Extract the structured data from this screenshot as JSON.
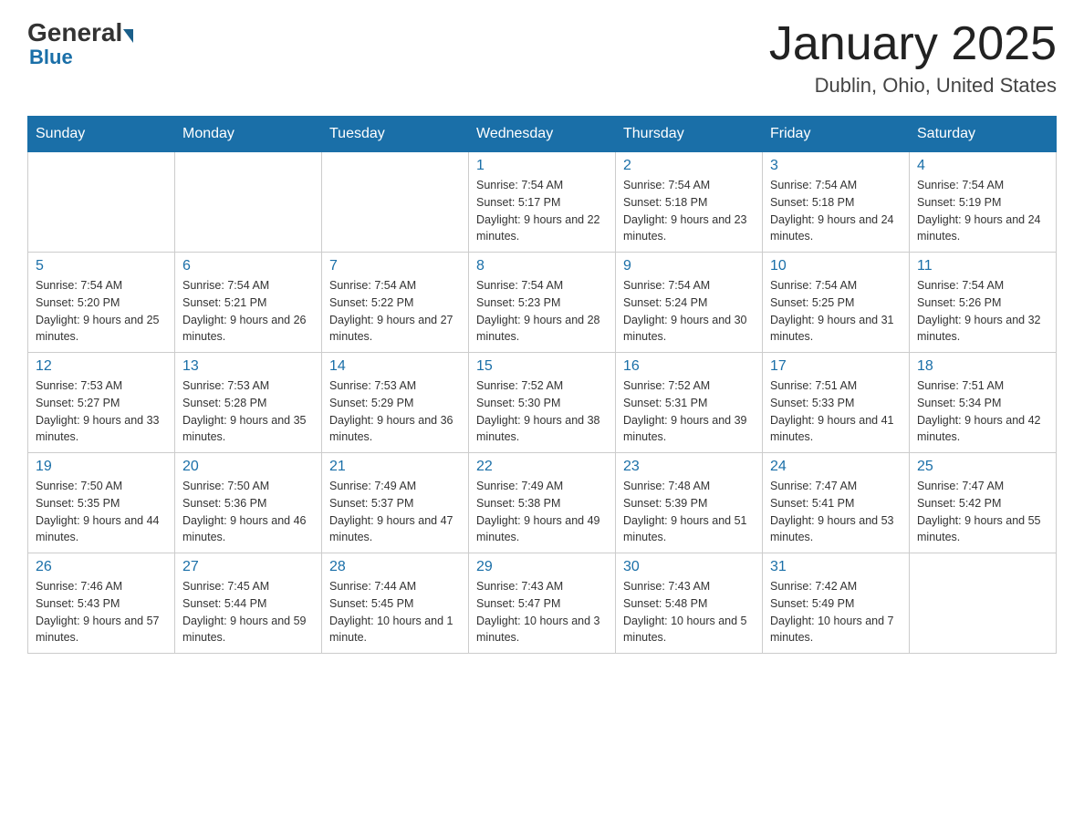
{
  "header": {
    "logo_general": "General",
    "logo_blue": "Blue",
    "month_title": "January 2025",
    "location": "Dublin, Ohio, United States"
  },
  "weekdays": [
    "Sunday",
    "Monday",
    "Tuesday",
    "Wednesday",
    "Thursday",
    "Friday",
    "Saturday"
  ],
  "weeks": [
    [
      {
        "day": "",
        "sunrise": "",
        "sunset": "",
        "daylight": ""
      },
      {
        "day": "",
        "sunrise": "",
        "sunset": "",
        "daylight": ""
      },
      {
        "day": "",
        "sunrise": "",
        "sunset": "",
        "daylight": ""
      },
      {
        "day": "1",
        "sunrise": "Sunrise: 7:54 AM",
        "sunset": "Sunset: 5:17 PM",
        "daylight": "Daylight: 9 hours and 22 minutes."
      },
      {
        "day": "2",
        "sunrise": "Sunrise: 7:54 AM",
        "sunset": "Sunset: 5:18 PM",
        "daylight": "Daylight: 9 hours and 23 minutes."
      },
      {
        "day": "3",
        "sunrise": "Sunrise: 7:54 AM",
        "sunset": "Sunset: 5:18 PM",
        "daylight": "Daylight: 9 hours and 24 minutes."
      },
      {
        "day": "4",
        "sunrise": "Sunrise: 7:54 AM",
        "sunset": "Sunset: 5:19 PM",
        "daylight": "Daylight: 9 hours and 24 minutes."
      }
    ],
    [
      {
        "day": "5",
        "sunrise": "Sunrise: 7:54 AM",
        "sunset": "Sunset: 5:20 PM",
        "daylight": "Daylight: 9 hours and 25 minutes."
      },
      {
        "day": "6",
        "sunrise": "Sunrise: 7:54 AM",
        "sunset": "Sunset: 5:21 PM",
        "daylight": "Daylight: 9 hours and 26 minutes."
      },
      {
        "day": "7",
        "sunrise": "Sunrise: 7:54 AM",
        "sunset": "Sunset: 5:22 PM",
        "daylight": "Daylight: 9 hours and 27 minutes."
      },
      {
        "day": "8",
        "sunrise": "Sunrise: 7:54 AM",
        "sunset": "Sunset: 5:23 PM",
        "daylight": "Daylight: 9 hours and 28 minutes."
      },
      {
        "day": "9",
        "sunrise": "Sunrise: 7:54 AM",
        "sunset": "Sunset: 5:24 PM",
        "daylight": "Daylight: 9 hours and 30 minutes."
      },
      {
        "day": "10",
        "sunrise": "Sunrise: 7:54 AM",
        "sunset": "Sunset: 5:25 PM",
        "daylight": "Daylight: 9 hours and 31 minutes."
      },
      {
        "day": "11",
        "sunrise": "Sunrise: 7:54 AM",
        "sunset": "Sunset: 5:26 PM",
        "daylight": "Daylight: 9 hours and 32 minutes."
      }
    ],
    [
      {
        "day": "12",
        "sunrise": "Sunrise: 7:53 AM",
        "sunset": "Sunset: 5:27 PM",
        "daylight": "Daylight: 9 hours and 33 minutes."
      },
      {
        "day": "13",
        "sunrise": "Sunrise: 7:53 AM",
        "sunset": "Sunset: 5:28 PM",
        "daylight": "Daylight: 9 hours and 35 minutes."
      },
      {
        "day": "14",
        "sunrise": "Sunrise: 7:53 AM",
        "sunset": "Sunset: 5:29 PM",
        "daylight": "Daylight: 9 hours and 36 minutes."
      },
      {
        "day": "15",
        "sunrise": "Sunrise: 7:52 AM",
        "sunset": "Sunset: 5:30 PM",
        "daylight": "Daylight: 9 hours and 38 minutes."
      },
      {
        "day": "16",
        "sunrise": "Sunrise: 7:52 AM",
        "sunset": "Sunset: 5:31 PM",
        "daylight": "Daylight: 9 hours and 39 minutes."
      },
      {
        "day": "17",
        "sunrise": "Sunrise: 7:51 AM",
        "sunset": "Sunset: 5:33 PM",
        "daylight": "Daylight: 9 hours and 41 minutes."
      },
      {
        "day": "18",
        "sunrise": "Sunrise: 7:51 AM",
        "sunset": "Sunset: 5:34 PM",
        "daylight": "Daylight: 9 hours and 42 minutes."
      }
    ],
    [
      {
        "day": "19",
        "sunrise": "Sunrise: 7:50 AM",
        "sunset": "Sunset: 5:35 PM",
        "daylight": "Daylight: 9 hours and 44 minutes."
      },
      {
        "day": "20",
        "sunrise": "Sunrise: 7:50 AM",
        "sunset": "Sunset: 5:36 PM",
        "daylight": "Daylight: 9 hours and 46 minutes."
      },
      {
        "day": "21",
        "sunrise": "Sunrise: 7:49 AM",
        "sunset": "Sunset: 5:37 PM",
        "daylight": "Daylight: 9 hours and 47 minutes."
      },
      {
        "day": "22",
        "sunrise": "Sunrise: 7:49 AM",
        "sunset": "Sunset: 5:38 PM",
        "daylight": "Daylight: 9 hours and 49 minutes."
      },
      {
        "day": "23",
        "sunrise": "Sunrise: 7:48 AM",
        "sunset": "Sunset: 5:39 PM",
        "daylight": "Daylight: 9 hours and 51 minutes."
      },
      {
        "day": "24",
        "sunrise": "Sunrise: 7:47 AM",
        "sunset": "Sunset: 5:41 PM",
        "daylight": "Daylight: 9 hours and 53 minutes."
      },
      {
        "day": "25",
        "sunrise": "Sunrise: 7:47 AM",
        "sunset": "Sunset: 5:42 PM",
        "daylight": "Daylight: 9 hours and 55 minutes."
      }
    ],
    [
      {
        "day": "26",
        "sunrise": "Sunrise: 7:46 AM",
        "sunset": "Sunset: 5:43 PM",
        "daylight": "Daylight: 9 hours and 57 minutes."
      },
      {
        "day": "27",
        "sunrise": "Sunrise: 7:45 AM",
        "sunset": "Sunset: 5:44 PM",
        "daylight": "Daylight: 9 hours and 59 minutes."
      },
      {
        "day": "28",
        "sunrise": "Sunrise: 7:44 AM",
        "sunset": "Sunset: 5:45 PM",
        "daylight": "Daylight: 10 hours and 1 minute."
      },
      {
        "day": "29",
        "sunrise": "Sunrise: 7:43 AM",
        "sunset": "Sunset: 5:47 PM",
        "daylight": "Daylight: 10 hours and 3 minutes."
      },
      {
        "day": "30",
        "sunrise": "Sunrise: 7:43 AM",
        "sunset": "Sunset: 5:48 PM",
        "daylight": "Daylight: 10 hours and 5 minutes."
      },
      {
        "day": "31",
        "sunrise": "Sunrise: 7:42 AM",
        "sunset": "Sunset: 5:49 PM",
        "daylight": "Daylight: 10 hours and 7 minutes."
      },
      {
        "day": "",
        "sunrise": "",
        "sunset": "",
        "daylight": ""
      }
    ]
  ]
}
